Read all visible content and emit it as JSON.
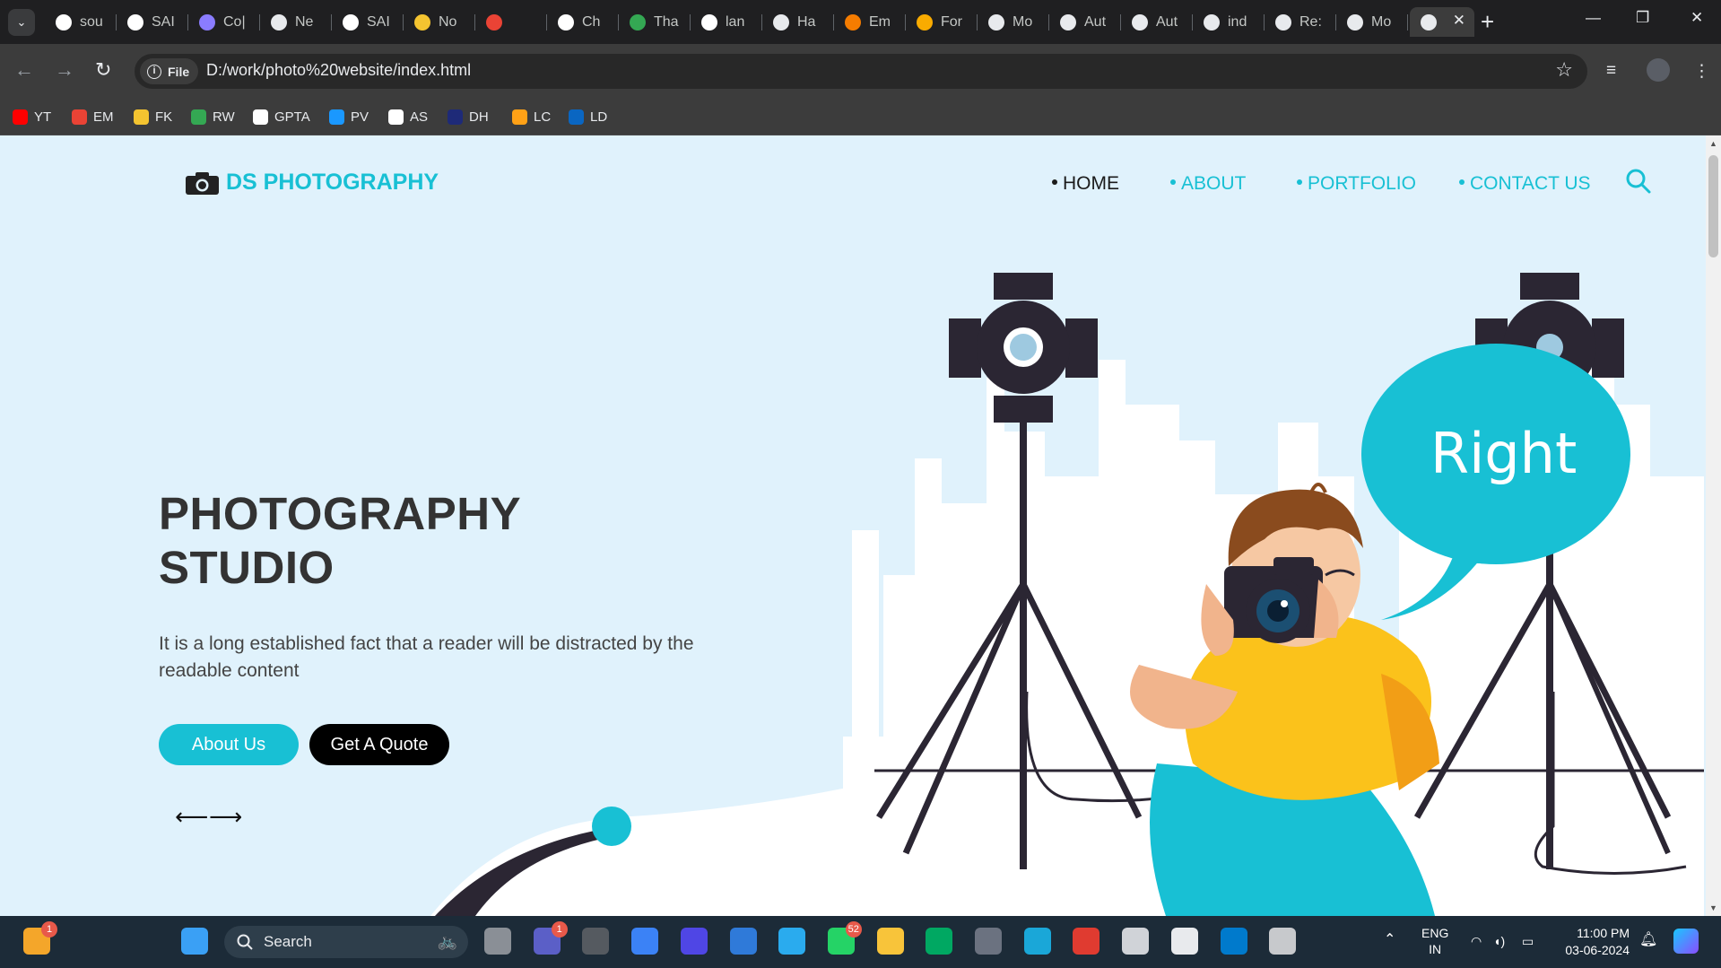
{
  "browser": {
    "tabs": [
      {
        "label": "sou",
        "icon": "github-icon",
        "color": "#ffffff"
      },
      {
        "label": "SAI",
        "icon": "grid-icon",
        "color": "#ffffff"
      },
      {
        "label": "Co|",
        "icon": "copilot-icon",
        "color": "#8a7cff"
      },
      {
        "label": "Ne",
        "icon": "chrome-icon",
        "color": "#e8eaed"
      },
      {
        "label": "SAI",
        "icon": "grid-icon",
        "color": "#ffffff"
      },
      {
        "label": "No",
        "icon": "notion-icon",
        "color": "#f4c430"
      },
      {
        "label": "",
        "icon": "gmail-icon",
        "color": "#ea4335"
      },
      {
        "label": "Ch",
        "icon": "openai-icon",
        "color": "#ffffff"
      },
      {
        "label": "Tha",
        "icon": "maps-icon",
        "color": "#34a853"
      },
      {
        "label": "lan",
        "icon": "google-icon",
        "color": "#ffffff"
      },
      {
        "label": "Ha",
        "icon": "globe-icon",
        "color": "#e8eaed"
      },
      {
        "label": "Em",
        "icon": "c-icon",
        "color": "#f57c00"
      },
      {
        "label": "For",
        "icon": "forms-icon",
        "color": "#f9ab00"
      },
      {
        "label": "Mo",
        "icon": "globe-icon",
        "color": "#e8eaed"
      },
      {
        "label": "Aut",
        "icon": "globe-icon",
        "color": "#e8eaed"
      },
      {
        "label": "Aut",
        "icon": "globe-icon",
        "color": "#e8eaed"
      },
      {
        "label": "ind",
        "icon": "globe-icon",
        "color": "#e8eaed"
      },
      {
        "label": "Re:",
        "icon": "globe-icon",
        "color": "#e8eaed"
      },
      {
        "label": "Mo",
        "icon": "globe-icon",
        "color": "#e8eaed"
      },
      {
        "label": "",
        "icon": "globe-icon",
        "color": "#e8eaed",
        "active": true
      }
    ],
    "new_tab": "+",
    "window_controls": {
      "minimize": "—",
      "restore": "❐",
      "close": "✕"
    },
    "address": {
      "chip": "File",
      "url": "D:/work/photo%20website/index.html"
    },
    "bookmarks": [
      {
        "label": "YT",
        "icon": "youtube-icon",
        "color": "#ff0000"
      },
      {
        "label": "EM",
        "icon": "gmail-icon",
        "color": "#ea4335"
      },
      {
        "label": "FK",
        "icon": "flipkart-icon",
        "color": "#f4c430"
      },
      {
        "label": "RW",
        "icon": "robot-icon",
        "color": "#34a853"
      },
      {
        "label": "GPTA",
        "icon": "openai-icon",
        "color": "#ffffff"
      },
      {
        "label": "PV",
        "icon": "prime-video-icon",
        "color": "#1a98ff"
      },
      {
        "label": "AS",
        "icon": "amazon-icon",
        "color": "#ffffff"
      },
      {
        "label": "DH",
        "icon": "dh-icon",
        "color": "#1e2a78"
      },
      {
        "label": "LC",
        "icon": "leetcode-icon",
        "color": "#ffa116"
      },
      {
        "label": "LD",
        "icon": "linkedin-icon",
        "color": "#0a66c2"
      }
    ]
  },
  "site": {
    "brand": "DS PHOTOGRAPHY",
    "nav": [
      "HOME",
      "ABOUT",
      "PORTFOLIO",
      "CONTACT US"
    ],
    "hero": {
      "title_line1": "PHOTOGRAPHY",
      "title_line2": "STUDIO",
      "description": "It is a long established fact that a reader will be distracted by the readable content",
      "btn_about": "About Us",
      "btn_quote": "Get A Quote",
      "arrow_prev": "⟵",
      "arrow_next": "⟶"
    },
    "bubble_text": "Right",
    "colors": {
      "accent": "#18c0d4",
      "background": "#e0f2fc",
      "dark": "#2b2633",
      "shirt": "#fbc21b"
    }
  },
  "taskbar": {
    "search": "Search",
    "apps": [
      {
        "name": "weather",
        "badge": "1"
      },
      {
        "name": "start"
      },
      {
        "name": "task-view"
      },
      {
        "name": "teams",
        "badge": "1"
      },
      {
        "name": "obs"
      },
      {
        "name": "store"
      },
      {
        "name": "editor"
      },
      {
        "name": "mail"
      },
      {
        "name": "telegram"
      },
      {
        "name": "whatsapp",
        "badge": "52"
      },
      {
        "name": "file-explorer"
      },
      {
        "name": "meet"
      },
      {
        "name": "calculator"
      },
      {
        "name": "edge"
      },
      {
        "name": "media-player"
      },
      {
        "name": "notes"
      },
      {
        "name": "chrome"
      },
      {
        "name": "vscode"
      },
      {
        "name": "snipping-tool"
      }
    ],
    "lang_top": "ENG",
    "lang_bottom": "IN",
    "time": "11:00 PM",
    "date": "03-06-2024"
  }
}
